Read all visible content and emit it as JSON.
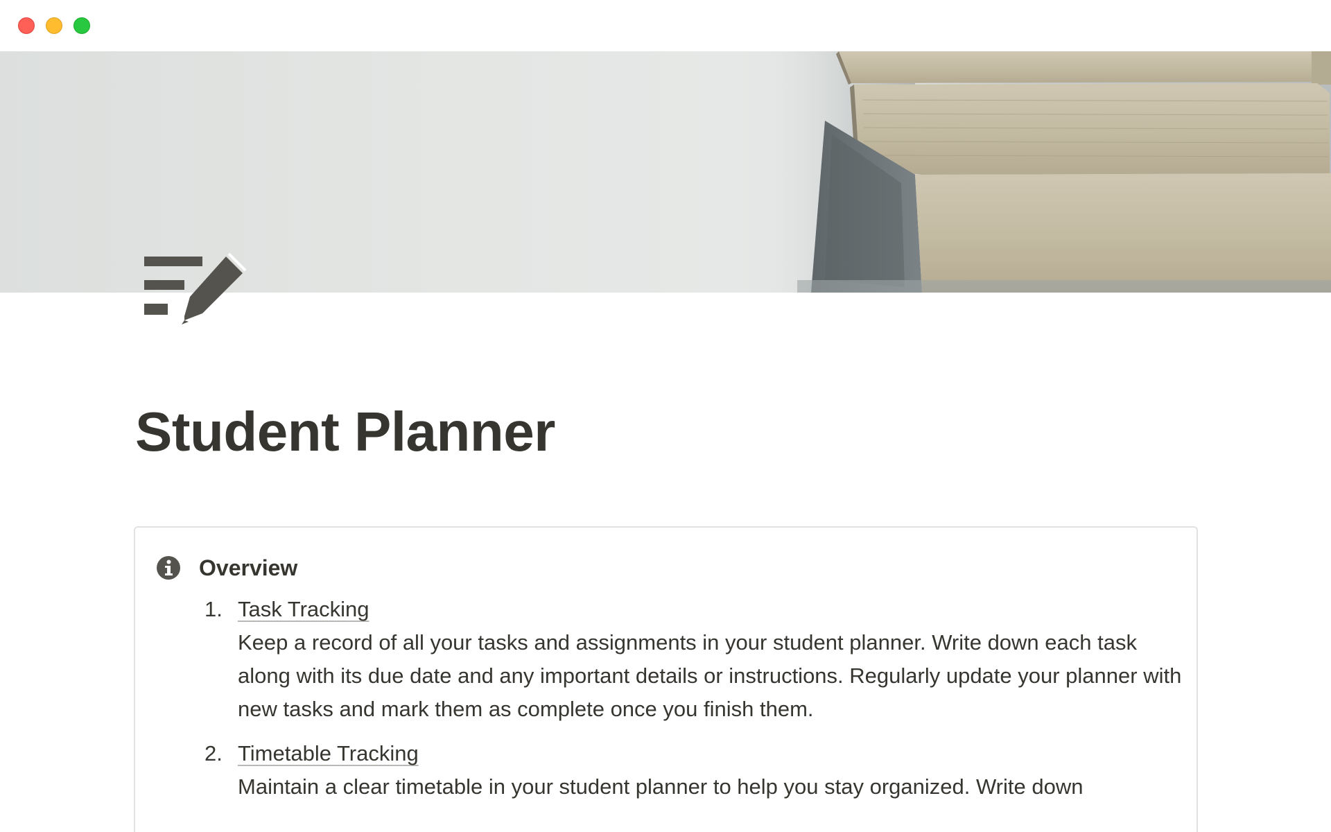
{
  "window": {
    "controls": [
      "close",
      "minimize",
      "zoom"
    ],
    "colors": {
      "close": "#fe5f57",
      "minimize": "#febc2e",
      "zoom": "#28c840"
    }
  },
  "cover": {
    "image": "stack-of-books-photo"
  },
  "page": {
    "icon": "notes-pencil-icon",
    "title": "Student Planner"
  },
  "callout": {
    "icon": "info-icon",
    "heading": "Overview",
    "items": [
      {
        "number": "1.",
        "title": "Task Tracking",
        "description": "Keep a record of all your tasks and assignments in your student planner. Write down each task along with its due date and any important details or instructions. Regularly update your planner with new tasks and mark them as complete once you finish them."
      },
      {
        "number": "2.",
        "title": "Timetable Tracking",
        "description": "Maintain a clear timetable in your student planner to help you stay organized. Write down"
      }
    ]
  }
}
